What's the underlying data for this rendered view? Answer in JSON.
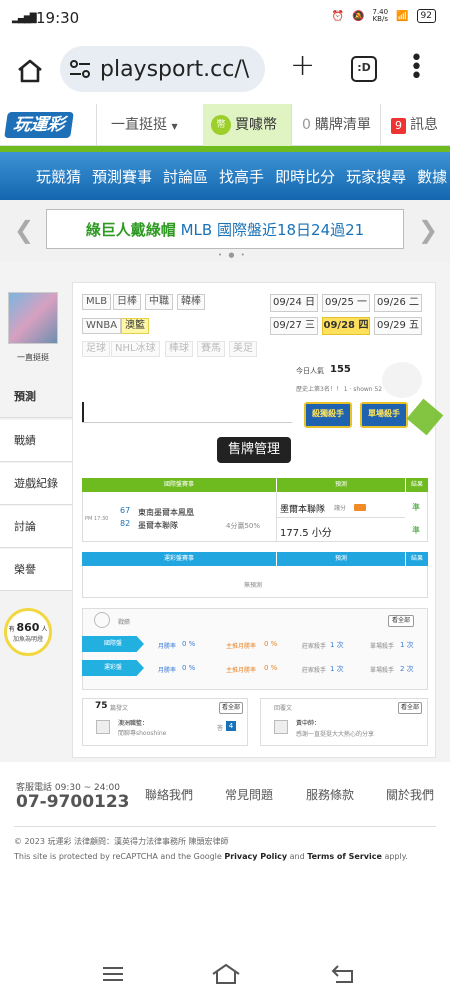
{
  "status": {
    "time": "19:30",
    "signal": "••ıl",
    "speed": "7.40\nKB/s",
    "battery": "92"
  },
  "browser": {
    "url": "playsport.cc/\\",
    "tab_label": ":D"
  },
  "site": {
    "logo": "玩運彩",
    "menu_label": "一直挺挺",
    "coin_label": "買噱幣",
    "coin_icon": "幣",
    "cart_count": "0",
    "cart_label": "購牌清單",
    "msg_count": "9",
    "msg_label": "訊息"
  },
  "nav": [
    "玩競猜",
    "預測賽事",
    "討論區",
    "找高手",
    "即時比分",
    "玩家搜尋",
    "數據"
  ],
  "banner": {
    "green": "綠巨人戴綠帽",
    "rest": " MLB 國際盤近18日24過21"
  },
  "profile": {
    "name": "一直挺挺"
  },
  "left_menu": [
    "預測",
    "戰績",
    "遊戲紀錄",
    "討論",
    "榮譽"
  ],
  "bulb": {
    "count": "860",
    "unit": "人",
    "caption": "加魚為明燈"
  },
  "leagues": {
    "row1": [
      "MLB",
      "日棒",
      "中職",
      "韓棒"
    ],
    "row2": [
      "WNBA",
      "澳籃"
    ],
    "row3": [
      "足球",
      "NHL冰球",
      "棒球",
      "賽馬",
      "美足"
    ]
  },
  "dates": [
    {
      "label": "09/24 日"
    },
    {
      "label": "09/25 一"
    },
    {
      "label": "09/26 二"
    },
    {
      "label": "09/27 三"
    },
    {
      "label": "09/28 四"
    },
    {
      "label": "09/29 五"
    }
  ],
  "stats": {
    "today_label": "今日人氣",
    "today_value": "155",
    "rank_text": "歷史上第3名！！ 1 · shown 52"
  },
  "badges": [
    "殺獨殺手",
    "單場殺手"
  ],
  "tooltip": "售牌管理",
  "table1": {
    "headers": [
      "國際盤賽事",
      "預測",
      "結果"
    ],
    "time": "PM 17:30",
    "team1_no": "67",
    "team1": "東南墨爾本鳳凰",
    "team2_no": "82",
    "team2": "墨爾本聯隊",
    "spread": "4分贏50%",
    "pick1": "墨爾本聯隊",
    "pick1_odds": "讓分",
    "pick1_result": "準",
    "pick2": "177.5 小分",
    "pick2_result": "準"
  },
  "table2": {
    "headers": [
      "運彩盤賽事",
      "預測",
      "結果"
    ],
    "empty": "無預測"
  },
  "record": {
    "title": "戰績",
    "more": "看全部",
    "rows": [
      {
        "label": "國際盤",
        "a_label": "月勝率",
        "a_val": "0 %",
        "b_label": "主推月勝率",
        "b_val": "0 %",
        "c_label": "莊家殺手",
        "c_val": "1 次",
        "d_label": "單場殺手",
        "d_val": "1 次"
      },
      {
        "label": "運彩盤",
        "a_label": "月勝率",
        "a_val": "0 %",
        "b_label": "主推月勝率",
        "b_val": "0 %",
        "c_label": "莊家殺手",
        "c_val": "1 次",
        "d_label": "單場殺手",
        "d_val": "2 次"
      }
    ],
    "accent": "#22b0e0"
  },
  "posts": {
    "count": "75",
    "count_label": "篇發文",
    "more": "看全部",
    "item_title": "澳洲職籃：",
    "item_sub": "閒聊專shooshine",
    "item_reply": "4",
    "reply_title": "回覆文",
    "reply_more": "看全部",
    "reply_user": "黃中帥：",
    "reply_text": "感謝一直挺挺大大熱心的分享"
  },
  "footer": {
    "phone_label": "客服電話 09:30 ~ 24:00",
    "phone": "07-9700123",
    "links": [
      "聯絡我們",
      "常見問題",
      "服務條款",
      "關於我們"
    ],
    "copyright": "© 2023 玩運彩 法律顧問：漢英得力法律事務所 陳頭宏律師",
    "recaptcha_pre": "This site is protected by reCAPTCHA and the Google ",
    "privacy": "Privacy Policy",
    "and": " and ",
    "terms": "Terms of Service",
    "apply": " apply."
  }
}
